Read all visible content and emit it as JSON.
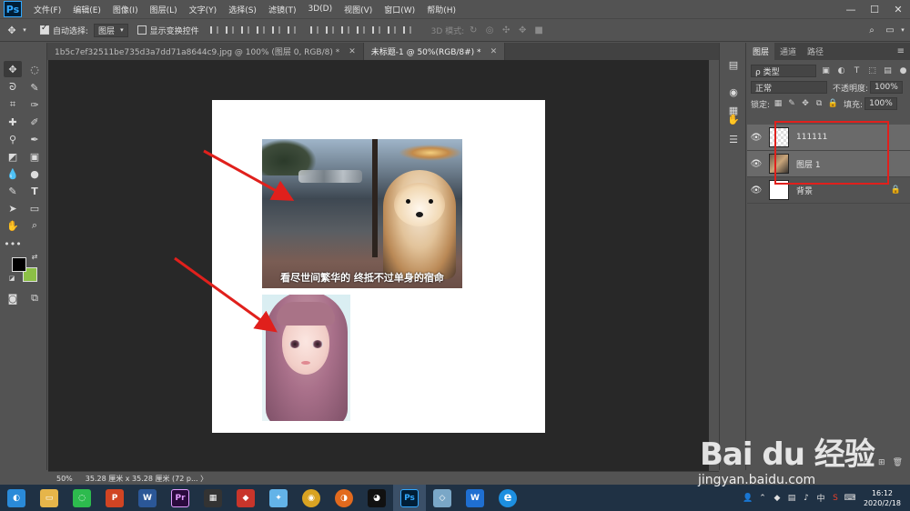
{
  "app": {
    "logo": "Ps"
  },
  "menu": [
    "文件(F)",
    "编辑(E)",
    "图像(I)",
    "图层(L)",
    "文字(Y)",
    "选择(S)",
    "滤镜(T)",
    "3D(D)",
    "视图(V)",
    "窗口(W)",
    "帮助(H)"
  ],
  "window_controls": {
    "minimize": "—",
    "maximize": "☐",
    "close": "✕"
  },
  "options": {
    "auto_select_label": "自动选择:",
    "auto_select_value": "图层",
    "show_transform_label": "显示变换控件",
    "mode_3d_label": "3D 模式:"
  },
  "tabs": [
    {
      "label": "1b5c7ef32511be735d3a7dd71a8644c9.jpg @ 100% (图层 0, RGB/8) *",
      "active": false
    },
    {
      "label": "未标题-1 @ 50%(RGB/8#) *",
      "active": true
    }
  ],
  "canvas": {
    "caption": "看尽世间繁华的 终抵不过单身的宿命"
  },
  "panel": {
    "tabs": [
      "图层",
      "通道",
      "路径"
    ],
    "filter_kind": "ρ 类型",
    "blend_mode": "正常",
    "opacity_label": "不透明度:",
    "opacity_value": "100%",
    "lock_label": "锁定:",
    "fill_label": "填充:",
    "fill_value": "100%",
    "layers": [
      {
        "name": "111111",
        "thumb": "checker",
        "selected": true
      },
      {
        "name": "图层 1",
        "thumb": "photo",
        "selected": true
      },
      {
        "name": "背景",
        "thumb": "white",
        "selected": false,
        "locked": true
      }
    ]
  },
  "status": {
    "zoom": "50%",
    "info": "35.28 厘米 x 35.28 厘米 (72 p...  〉"
  },
  "taskbar": {
    "apps": [
      {
        "name": "browser-360",
        "color": "#2a8ad8",
        "glyph": "◐"
      },
      {
        "name": "file-explorer",
        "color": "#e6b54a",
        "glyph": "▭"
      },
      {
        "name": "wechat",
        "color": "#2dbb4e",
        "glyph": "◌"
      },
      {
        "name": "powerpoint",
        "color": "#d04423",
        "glyph": "P"
      },
      {
        "name": "word",
        "color": "#2b5797",
        "glyph": "W"
      },
      {
        "name": "premiere",
        "color": "#2a0a3d",
        "glyph": "Pr"
      },
      {
        "name": "video-editor",
        "color": "#333333",
        "glyph": "▦"
      },
      {
        "name": "app-red",
        "color": "#c8352b",
        "glyph": "◆"
      },
      {
        "name": "app-bird",
        "color": "#63b3e8",
        "glyph": "✦"
      },
      {
        "name": "chrome",
        "color": "#d9a322",
        "glyph": "◉"
      },
      {
        "name": "app-orange",
        "color": "#e26a1e",
        "glyph": "◑"
      },
      {
        "name": "qq",
        "color": "#111111",
        "glyph": "◕"
      },
      {
        "name": "photoshop",
        "color": "#001e36",
        "glyph": "Ps"
      },
      {
        "name": "app-cube",
        "color": "#7aa7c7",
        "glyph": "◇"
      },
      {
        "name": "wps",
        "color": "#1f6fd1",
        "glyph": "W"
      },
      {
        "name": "internet-explorer",
        "color": "#1d8fe0",
        "glyph": "e"
      }
    ],
    "clock_time": "16:12",
    "clock_date": "2020/2/18"
  },
  "watermark": {
    "brand": "Bai du 经验",
    "url": "jingyan.baidu.com"
  }
}
